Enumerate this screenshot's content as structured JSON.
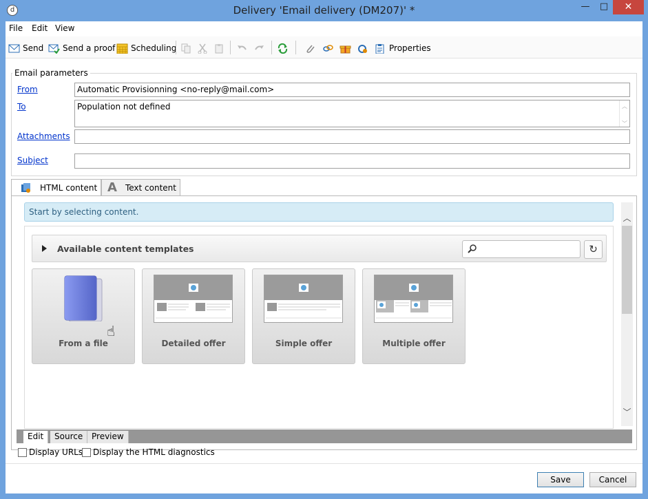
{
  "window": {
    "title": "Delivery 'Email delivery (DM207)' *",
    "app_icon": "d",
    "min_glyph": "—",
    "max_glyph": "□",
    "close_glyph": "✕"
  },
  "menu": [
    "File",
    "Edit",
    "View"
  ],
  "toolbar": {
    "send": "Send",
    "send_proof": "Send a proof",
    "scheduling": "Scheduling",
    "properties": "Properties"
  },
  "params": {
    "legend": "Email parameters",
    "from_label": "From",
    "from_value": "Automatic Provisionning <no-reply@mail.com>",
    "to_label": "To",
    "to_value": "Population not defined",
    "attachments_label": "Attachments",
    "attachments_value": "",
    "subject_label": "Subject",
    "subject_value": ""
  },
  "tabs": {
    "html": "HTML content",
    "text": "Text content"
  },
  "info": "Start by selecting content.",
  "templates": {
    "title": "Available content templates",
    "search_value": "",
    "cards": [
      "From a file",
      "Detailed offer",
      "Simple offer",
      "Multiple offer"
    ]
  },
  "bottom_tabs": [
    "Edit",
    "Source",
    "Preview"
  ],
  "checkboxes": {
    "display_urls": "Display URLs",
    "html_diag": "Display the HTML diagnostics"
  },
  "buttons": {
    "save": "Save",
    "cancel": "Cancel"
  },
  "colors": {
    "accent": "#6fa3de",
    "link": "#0033cc",
    "info_bg": "#d6ecf6",
    "close": "#c7463e"
  }
}
